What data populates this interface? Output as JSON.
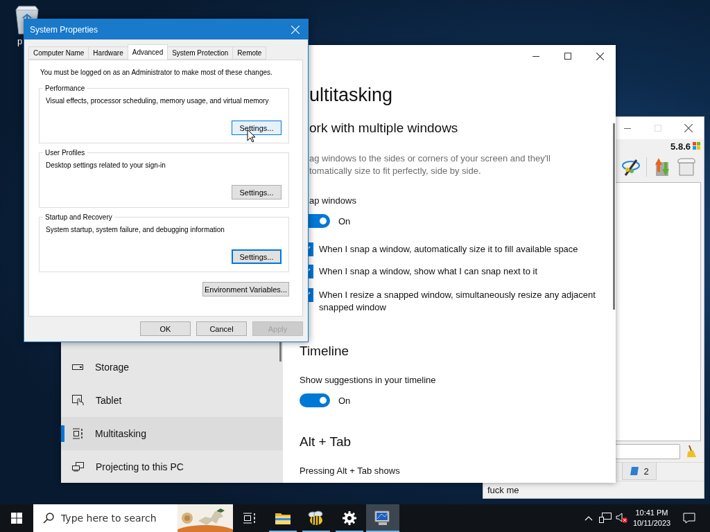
{
  "desktop": {
    "icons": [
      {
        "label": "p"
      }
    ]
  },
  "background_window": {
    "version": "5.8.6",
    "tabs": [
      {
        "label": "2"
      }
    ],
    "status": "fuck me"
  },
  "settings_window": {
    "nav": [
      {
        "label": "Storage",
        "selected": false
      },
      {
        "label": "Tablet",
        "selected": false
      },
      {
        "label": "Multitasking",
        "selected": true
      },
      {
        "label": "Projecting to this PC",
        "selected": false
      }
    ],
    "title": "ultitasking",
    "section": "ork with multiple windows",
    "description_lines": [
      "ag windows to the sides or corners of your screen and they'll",
      "tomatically size to fit perfectly, side by side."
    ],
    "snap": {
      "label": "ap windows",
      "on": true,
      "state_label": "On"
    },
    "options": [
      {
        "label": "When I snap a window, automatically size it to fill available space",
        "checked": true
      },
      {
        "label": "When I snap a window, show what I can snap next to it",
        "checked": true
      },
      {
        "label": "When I resize a snapped window, simultaneously resize any adjacent snapped window",
        "checked": true
      }
    ],
    "timeline": {
      "heading": "Timeline",
      "label": "Show suggestions in your timeline",
      "on": true,
      "state_label": "On"
    },
    "alt_tab": {
      "heading": "Alt + Tab",
      "label": "Pressing Alt + Tab shows"
    }
  },
  "system_properties": {
    "title": "System Properties",
    "tabs": [
      {
        "label": "Computer Name",
        "selected": false
      },
      {
        "label": "Hardware",
        "selected": false
      },
      {
        "label": "Advanced",
        "selected": true
      },
      {
        "label": "System Protection",
        "selected": false
      },
      {
        "label": "Remote",
        "selected": false
      }
    ],
    "notice": "You must be logged on as an Administrator to make most of these changes.",
    "groups": [
      {
        "title": "Performance",
        "description": "Visual effects, processor scheduling, memory usage, and virtual memory",
        "button": "Settings...",
        "hovered": true,
        "focused": false
      },
      {
        "title": "User Profiles",
        "description": "Desktop settings related to your sign-in",
        "button": "Settings...",
        "hovered": false,
        "focused": false
      },
      {
        "title": "Startup and Recovery",
        "description": "System startup, system failure, and debugging information",
        "button": "Settings...",
        "hovered": false,
        "focused": true
      }
    ],
    "environment_button": "Environment Variables...",
    "buttons": [
      {
        "label": "OK",
        "disabled": false
      },
      {
        "label": "Cancel",
        "disabled": false
      },
      {
        "label": "Apply",
        "disabled": true
      }
    ]
  },
  "taskbar": {
    "search_placeholder": "Type here to search",
    "apps": [
      {
        "running": false,
        "active": false
      },
      {
        "running": true,
        "active": false
      },
      {
        "running": true,
        "active": false
      },
      {
        "running": true,
        "active": false
      },
      {
        "running": true,
        "active": true
      }
    ],
    "time": "10:41 PM",
    "date": "10/11/2023"
  }
}
